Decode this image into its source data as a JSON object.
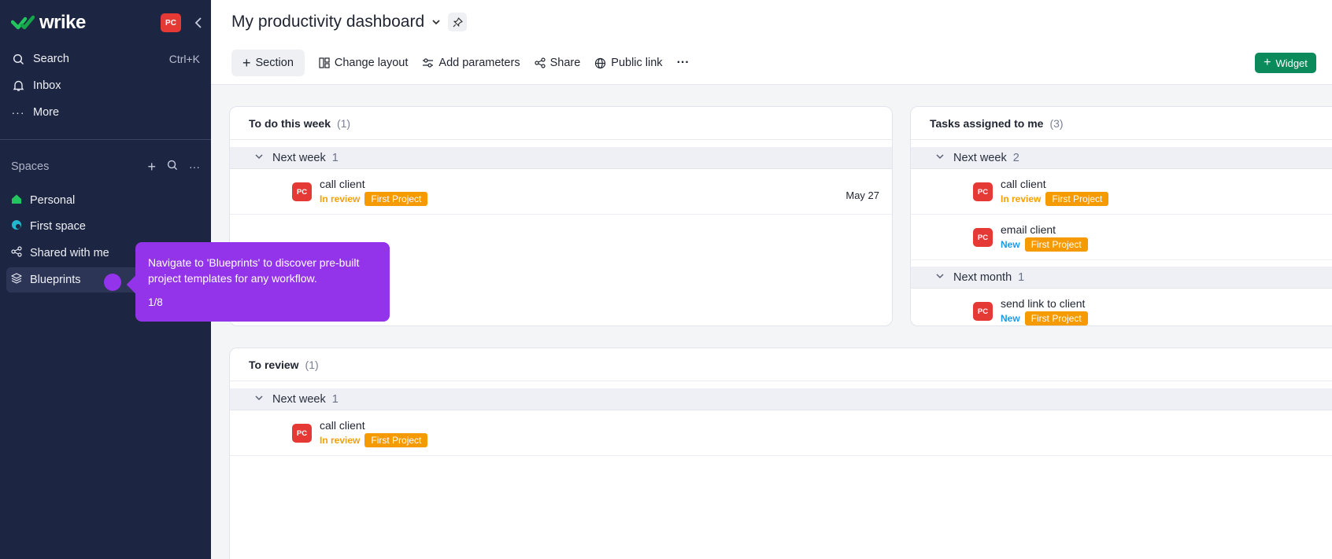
{
  "colors": {
    "sidebar_bg": "#1c2541",
    "accent_purple": "#9333ea",
    "widget_green": "#0b8a5b",
    "avatar_red": "#e53935",
    "tag_orange": "#f59a00",
    "status_review": "#f5a000",
    "status_new": "#1e9be0"
  },
  "sidebar": {
    "logo": "wrike",
    "user_badge": "PC",
    "search_label": "Search",
    "search_shortcut": "Ctrl+K",
    "inbox_label": "Inbox",
    "more_label": "More",
    "spaces_label": "Spaces",
    "spaces": [
      {
        "label": "Personal",
        "icon": "home-icon"
      },
      {
        "label": "First space",
        "icon": "space-icon"
      },
      {
        "label": "Shared with me",
        "icon": "share-icon"
      },
      {
        "label": "Blueprints",
        "icon": "layers-icon"
      }
    ]
  },
  "tooltip": {
    "text": "Navigate to 'Blueprints' to discover pre-built project templates for any workflow.",
    "step": "1/8"
  },
  "header": {
    "title": "My productivity dashboard",
    "toolbar": {
      "section": "Section",
      "change_layout": "Change layout",
      "add_parameters": "Add parameters",
      "share": "Share",
      "public_link": "Public link",
      "widget": "Widget"
    }
  },
  "widgets": {
    "todo": {
      "title": "To do this week",
      "count": "(1)",
      "groups": [
        {
          "label": "Next week",
          "count": "1",
          "tasks": [
            {
              "avatar": "PC",
              "name": "call client",
              "status": "In review",
              "project": "First Project",
              "date": "May 27"
            }
          ]
        }
      ]
    },
    "assigned": {
      "title": "Tasks assigned to me",
      "count": "(3)",
      "groups": [
        {
          "label": "Next week",
          "count": "2",
          "tasks": [
            {
              "avatar": "PC",
              "name": "call client",
              "status": "In review",
              "project": "First Project"
            },
            {
              "avatar": "PC",
              "name": "email client",
              "status": "New",
              "project": "First Project"
            }
          ]
        },
        {
          "label": "Next month",
          "count": "1",
          "tasks": [
            {
              "avatar": "PC",
              "name": "send link to client",
              "status": "New",
              "project": "First Project"
            }
          ]
        }
      ]
    },
    "review": {
      "title": "To review",
      "count": "(1)",
      "groups": [
        {
          "label": "Next week",
          "count": "1",
          "tasks": [
            {
              "avatar": "PC",
              "name": "call client",
              "status": "In review",
              "project": "First Project"
            }
          ]
        }
      ]
    }
  }
}
